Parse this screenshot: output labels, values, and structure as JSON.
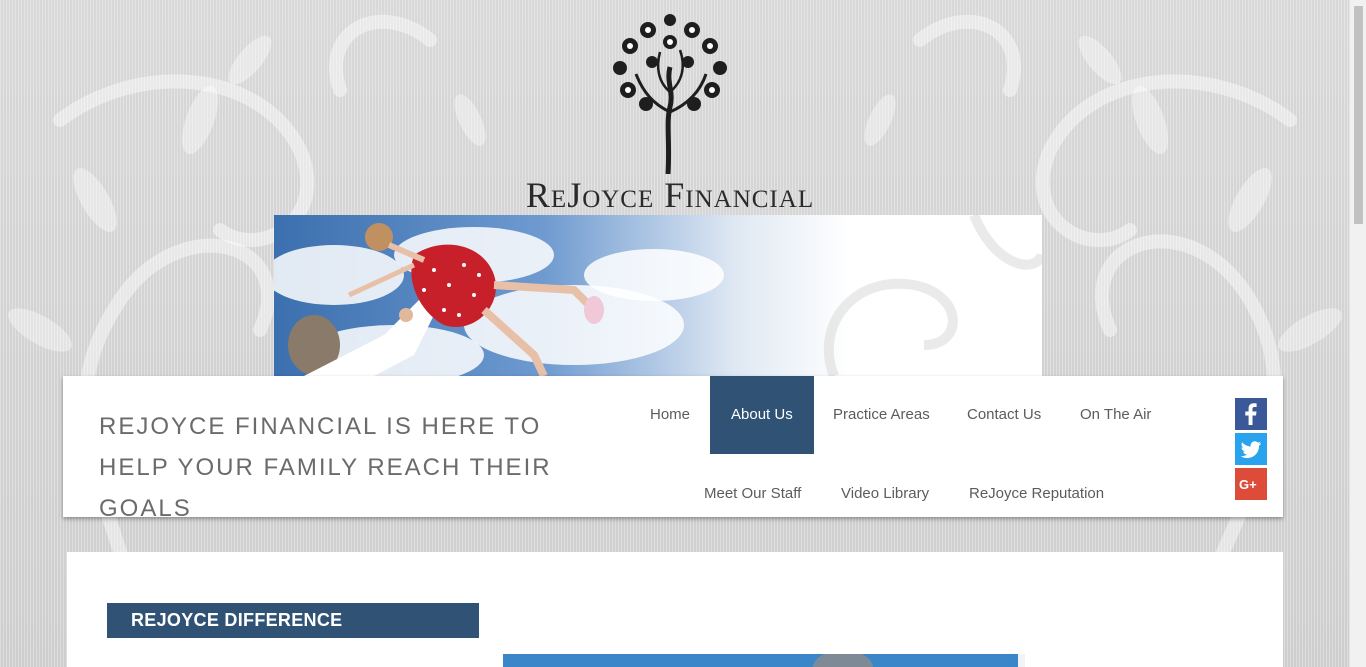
{
  "site": {
    "logo_text": "ReJoyce Financial"
  },
  "header": {
    "tagline": "REJOYCE FINANCIAL IS HERE TO HELP YOUR FAMILY REACH THEIR GOALS"
  },
  "nav": {
    "items": [
      {
        "label": "Home",
        "active": false
      },
      {
        "label": "About Us",
        "active": true
      },
      {
        "label": "Practice Areas",
        "active": false
      },
      {
        "label": "Contact Us",
        "active": false
      },
      {
        "label": "On The Air",
        "active": false
      },
      {
        "label": "Meet Our Staff",
        "active": false
      },
      {
        "label": "Video Library",
        "active": false
      },
      {
        "label": "ReJoyce Reputation",
        "active": false
      }
    ]
  },
  "social": [
    {
      "icon": "facebook-icon",
      "color": "#3b5998"
    },
    {
      "icon": "twitter-icon",
      "color": "#2aa3ef"
    },
    {
      "icon": "google-plus-icon",
      "color": "#dd4b39"
    }
  ],
  "content": {
    "section_heading": "REJOYCE DIFFERENCE"
  },
  "colors": {
    "accent": "#2f5275",
    "text_gray": "#5c5c5c"
  }
}
